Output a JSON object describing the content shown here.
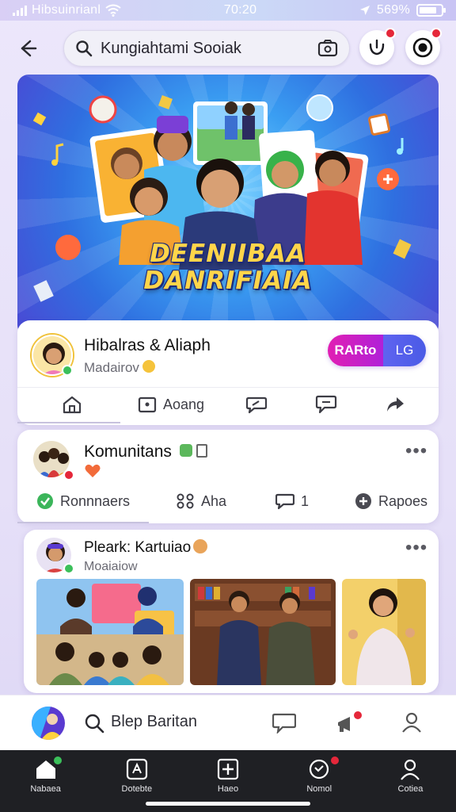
{
  "status_bar": {
    "carrier": "Hibsuinrianl",
    "time": "70:20",
    "battery": "569%",
    "battery_level": 0.8
  },
  "search": {
    "query": "Kungiahtami Sooiak"
  },
  "banner": {
    "title_line1": "DEENIIBAA",
    "title_line2": "DANRIFIAIA"
  },
  "live_post": {
    "author": "Hibalras & Aliaph",
    "subtitle": "Madairov",
    "toggle_left": "RARto",
    "toggle_right": "LG",
    "actions": [
      {
        "icon": "home-icon",
        "label": ""
      },
      {
        "icon": "frame-icon",
        "label": "Aoang"
      },
      {
        "icon": "comment-icon",
        "label": ""
      },
      {
        "icon": "message-icon",
        "label": ""
      },
      {
        "icon": "share-icon",
        "label": ""
      }
    ]
  },
  "community_post": {
    "title": "Komunitans",
    "more": "•••",
    "actions": [
      {
        "icon": "check-icon",
        "label": "Ronnnaers"
      },
      {
        "icon": "grid-icon",
        "label": "Aha"
      },
      {
        "icon": "comment-icon",
        "label": "1"
      },
      {
        "icon": "plus-circle-icon",
        "label": "Rapoes"
      }
    ]
  },
  "photo_post": {
    "author": "Pleark: Kartuiao",
    "subtitle": "Moaiaiow",
    "more": "•••"
  },
  "composer": {
    "placeholder": "Blep Baritan"
  },
  "nav": {
    "items": [
      {
        "label": "Nabaea",
        "icon": "home-icon"
      },
      {
        "label": "Dotebte",
        "icon": "compass-icon"
      },
      {
        "label": "Haeo",
        "icon": "plus-square-icon"
      },
      {
        "label": "Nomol",
        "icon": "notification-icon"
      },
      {
        "label": "Cotiea",
        "icon": "profile-icon"
      }
    ]
  },
  "colors": {
    "accent": "#5a5be6",
    "live_pink": "#d81fc0",
    "badge_red": "#e5273a",
    "nav_bg": "#1f2024"
  }
}
